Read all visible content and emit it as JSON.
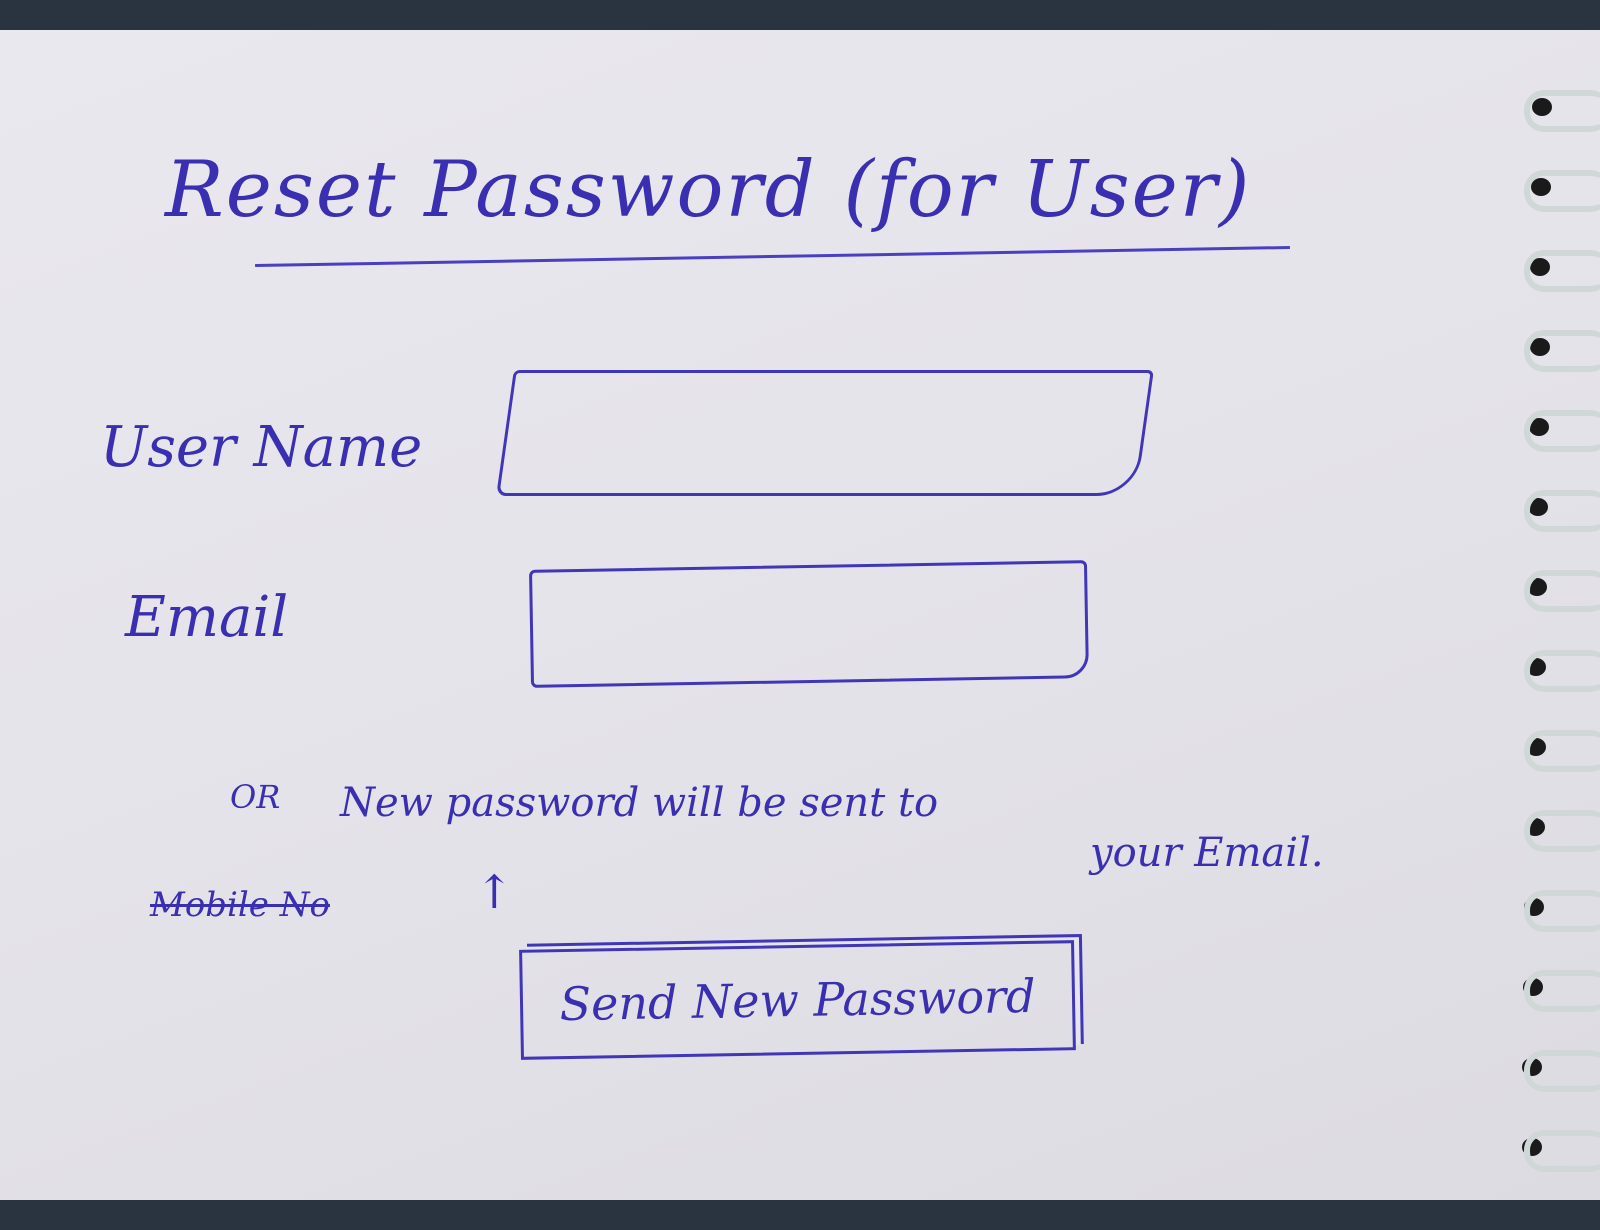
{
  "title": "Reset Password (for User)",
  "form": {
    "username_label": "User Name",
    "username_value": "",
    "email_label": "Email",
    "email_value": "",
    "struck_option": "Mobile No",
    "bullet": "OR",
    "note_line1": "New password will be sent to",
    "note_line2": "your Email.",
    "submit_label": "Send New Password"
  },
  "colors": {
    "ink": "#3a2fb0",
    "paper": "#e6e5eb"
  }
}
